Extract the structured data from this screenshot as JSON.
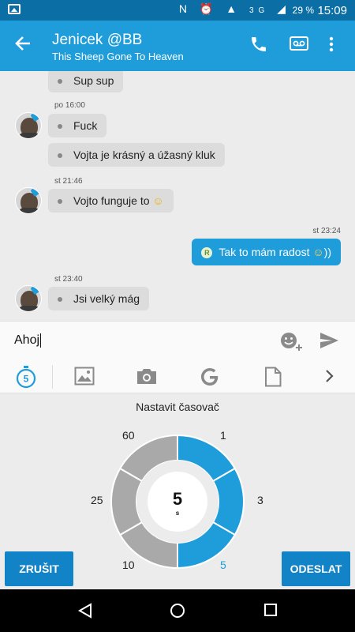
{
  "status_bar": {
    "network": "3G",
    "battery": "29 %",
    "time": "15:09"
  },
  "header": {
    "title": "Jenicek @BB",
    "subtitle": "This Sheep Gone To Heaven"
  },
  "messages": [
    {
      "text": "Sup sup"
    },
    {
      "time": "po 16:00",
      "text": "Fuck"
    },
    {
      "text": "Vojta je krásný a úžasný kluk"
    },
    {
      "time": "st 21:46",
      "text": "Vojto funguje to"
    },
    {
      "time": "st 23:24",
      "text": "Tak to mám radost",
      "badge": "R"
    },
    {
      "time": "st 23:40",
      "text": "Jsi velký mág"
    }
  ],
  "input": {
    "value": "Ahoj"
  },
  "toolbar": {
    "timer_value": "5"
  },
  "timer": {
    "title": "Nastavit časovač",
    "labels": [
      "60",
      "1",
      "25",
      "3",
      "10",
      "5"
    ],
    "center_value": "5",
    "center_unit": "s",
    "selected": "5",
    "cancel_label": "ZRUŠIT",
    "send_label": "ODESLAT"
  },
  "colors": {
    "accent": "#1f9ddb",
    "status_bar": "#0b6fa6",
    "button": "#1283c7",
    "segment_inactive": "#a9a9a9"
  }
}
